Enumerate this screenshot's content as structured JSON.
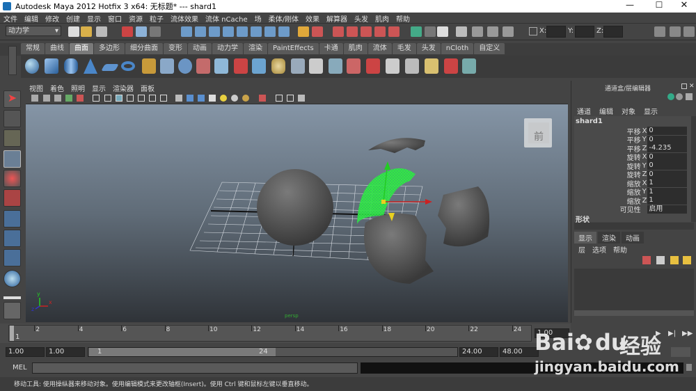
{
  "window": {
    "title": "Autodesk Maya 2012 Hotfix 3 x64: 无标题*   ---   shard1"
  },
  "menubar": [
    "文件",
    "编辑",
    "修改",
    "创建",
    "显示",
    "窗口",
    "资源",
    "粒子",
    "流体效果",
    "流体 nCache",
    "场",
    "柔体/刚体",
    "效果",
    "解算器",
    "头发",
    "肌肉",
    "帮助"
  ],
  "status": {
    "mode": "动力学",
    "x_label": "X:",
    "y_label": "Y:",
    "z_label": "Z:"
  },
  "shelf_tabs": [
    "常规",
    "曲线",
    "曲面",
    "多边形",
    "细分曲面",
    "变形",
    "动画",
    "动力学",
    "渲染",
    "PaintEffects",
    "卡通",
    "肌肉",
    "流体",
    "毛发",
    "头发",
    "nCloth",
    "自定义"
  ],
  "shelf_active": "曲面",
  "viewport": {
    "menu": [
      "视图",
      "着色",
      "照明",
      "显示",
      "渲染器",
      "面板"
    ],
    "camera_label": "persp",
    "viewcube_label": "前",
    "axis": {
      "x": "x",
      "y": "y",
      "z": "z"
    }
  },
  "channel_box": {
    "header": "通道盒/层编辑器",
    "menu": [
      "通道",
      "编辑",
      "对象",
      "显示"
    ],
    "object": "shard1",
    "channels": [
      {
        "name": "平移",
        "axis": "X",
        "value": "0"
      },
      {
        "name": "平移",
        "axis": "Y",
        "value": "0"
      },
      {
        "name": "平移",
        "axis": "Z",
        "value": "-4.235"
      },
      {
        "name": "旋转",
        "axis": "X",
        "value": "0"
      },
      {
        "name": "旋转",
        "axis": "Y",
        "value": "0"
      },
      {
        "name": "旋转",
        "axis": "Z",
        "value": "0"
      },
      {
        "name": "缩放",
        "axis": "X",
        "value": "1"
      },
      {
        "name": "缩放",
        "axis": "Y",
        "value": "1"
      },
      {
        "name": "缩放",
        "axis": "Z",
        "value": "1"
      },
      {
        "name": "可见性",
        "axis": "",
        "value": "启用"
      }
    ],
    "shapes_label": "形状",
    "layer_tabs": [
      "显示",
      "渲染",
      "动画"
    ],
    "layer_menu": [
      "层",
      "选项",
      "帮助"
    ]
  },
  "timeline": {
    "ticks": [
      "2",
      "4",
      "6",
      "8",
      "10",
      "12",
      "14",
      "16",
      "18",
      "20",
      "22",
      "24"
    ],
    "current": "1",
    "current_frame_field": "1.00"
  },
  "range": {
    "start": "1.00",
    "start2": "1.00",
    "slider_start": "1",
    "slider_end": "24",
    "end": "24.00",
    "end2": "48.00"
  },
  "command": {
    "label": "MEL"
  },
  "help_line": "移动工具: 使用操纵器来移动对象。使用编辑模式来更改轴枢(Insert)。使用 Ctrl 键和鼠标左键以垂直移动。",
  "watermark": {
    "brand": "Bai",
    "brand2": "du",
    "cn": "经验",
    "url": "jingyan.baidu.com"
  }
}
